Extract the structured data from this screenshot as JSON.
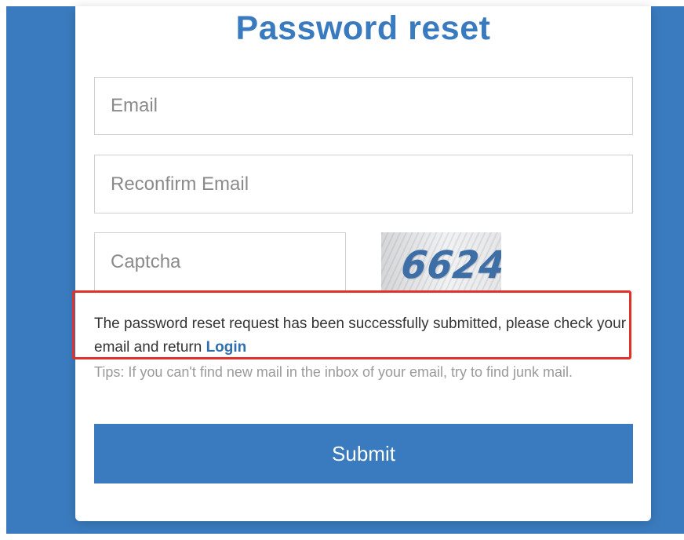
{
  "page": {
    "title": "Password reset"
  },
  "form": {
    "email_placeholder": "Email",
    "email_value": "",
    "reconfirm_placeholder": "Reconfirm Email",
    "reconfirm_value": "",
    "captcha_placeholder": "Captcha",
    "captcha_value": "",
    "captcha_image_text": "6624",
    "submit_label": "Submit"
  },
  "message": {
    "text": "The password reset request has been successfully submitted, please check your email and return ",
    "link_label": "Login"
  },
  "tips": {
    "text": "Tips: If you can't find new mail in the inbox of your email, try to find junk mail."
  },
  "colors": {
    "accent": "#3a7bbf",
    "highlight_border": "#e0322b",
    "link": "#2f6fae"
  }
}
